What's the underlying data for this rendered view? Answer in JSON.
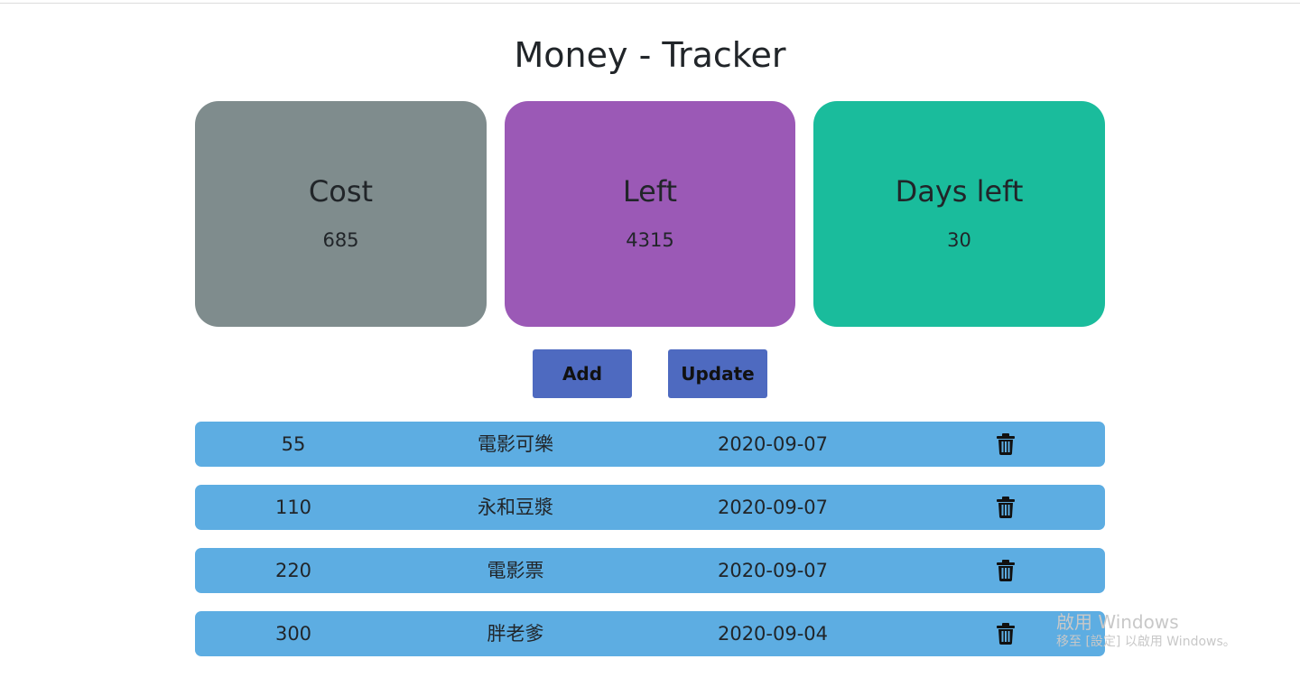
{
  "app": {
    "title": "Money - Tracker"
  },
  "summary": {
    "cost": {
      "label": "Cost",
      "value": "685",
      "color": "#7f8c8d"
    },
    "left": {
      "label": "Left",
      "value": "4315",
      "color": "#9b59b6"
    },
    "days_left": {
      "label": "Days left",
      "value": "30",
      "color": "#1abc9c"
    }
  },
  "actions": {
    "add_label": "Add",
    "update_label": "Update",
    "button_color": "#4e6ac0"
  },
  "entries": {
    "row_color": "#5dade2",
    "icon": "trash-icon",
    "items": [
      {
        "amount": "55",
        "name": "電影可樂",
        "date": "2020-09-07"
      },
      {
        "amount": "110",
        "name": "永和豆漿",
        "date": "2020-09-07"
      },
      {
        "amount": "220",
        "name": "電影票",
        "date": "2020-09-07"
      },
      {
        "amount": "300",
        "name": "胖老爹",
        "date": "2020-09-04"
      }
    ]
  },
  "watermark": {
    "line1": "啟用 Windows",
    "line2": "移至 [設定] 以啟用 Windows。"
  }
}
